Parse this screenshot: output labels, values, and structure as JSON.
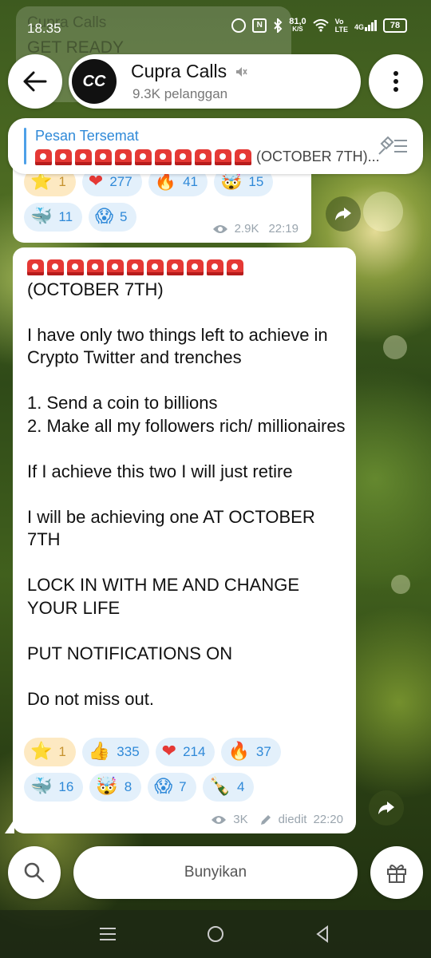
{
  "status_bar": {
    "time": "18.35",
    "net_speed_value": "81,0",
    "net_speed_unit": "K/S",
    "volte_top": "Vo",
    "volte_bottom": "LTE",
    "signal": "4G",
    "battery": "78"
  },
  "ghost_preview": {
    "line1": "Cupra Calls",
    "line2": "GET READY"
  },
  "header": {
    "avatar_text": "CC",
    "title": "Cupra Calls",
    "subtitle": "9.3K pelanggan"
  },
  "pinned": {
    "label": "Pesan Tersemat",
    "text": "(OCTOBER 7TH)..."
  },
  "message1": {
    "reactions": [
      {
        "emoji": "⭐",
        "count": "1",
        "mine": true
      },
      {
        "emoji": "❤",
        "count": "277",
        "mine": false
      },
      {
        "emoji": "🔥",
        "count": "41",
        "mine": false
      },
      {
        "emoji": "🤯",
        "count": "15",
        "mine": false
      },
      {
        "emoji": "🐳",
        "count": "11",
        "mine": false
      },
      {
        "emoji": "😱",
        "count": "5",
        "mine": false
      }
    ],
    "views": "2.9K",
    "time": "22:19"
  },
  "message2": {
    "date_line": "(OCTOBER 7TH)",
    "p1": "I have only two things left to achieve in Crypto Twitter and trenches",
    "p2a": "1. Send a coin to billions",
    "p2b": "2. Make all my followers rich/ millionaires",
    "p3": "If I achieve this two I will just retire",
    "p4": "I will be achieving one AT OCTOBER 7TH",
    "p5": "LOCK IN WITH ME AND CHANGE YOUR LIFE",
    "p6": "PUT NOTIFICATIONS ON",
    "p7": "Do not miss out.",
    "reactions": [
      {
        "emoji": "⭐",
        "count": "1",
        "mine": true
      },
      {
        "emoji": "👍",
        "count": "335",
        "mine": false
      },
      {
        "emoji": "❤",
        "count": "214",
        "mine": false
      },
      {
        "emoji": "🔥",
        "count": "37",
        "mine": false
      },
      {
        "emoji": "🐳",
        "count": "16",
        "mine": false
      },
      {
        "emoji": "🤯",
        "count": "8",
        "mine": false
      },
      {
        "emoji": "😱",
        "count": "7",
        "mine": false
      },
      {
        "emoji": "🍾",
        "count": "4",
        "mine": false
      }
    ],
    "views": "3K",
    "edited": "diedit",
    "time": "22:20"
  },
  "bottom": {
    "mute_label": "Bunyikan"
  },
  "colors": {
    "accent": "#2f89d8",
    "siren_red": "#e53935",
    "reaction_bg": "#e3f0fb",
    "reaction_mine_bg": "#fde9c2"
  },
  "icons": [
    "back-arrow-icon",
    "muted-speaker-icon",
    "more-vertical-icon",
    "unpin-list-icon",
    "eye-icon",
    "edited-pencil-icon",
    "share-arrow-icon",
    "search-icon",
    "gift-icon",
    "nav-menu-icon",
    "nav-home-icon",
    "nav-back-icon"
  ]
}
